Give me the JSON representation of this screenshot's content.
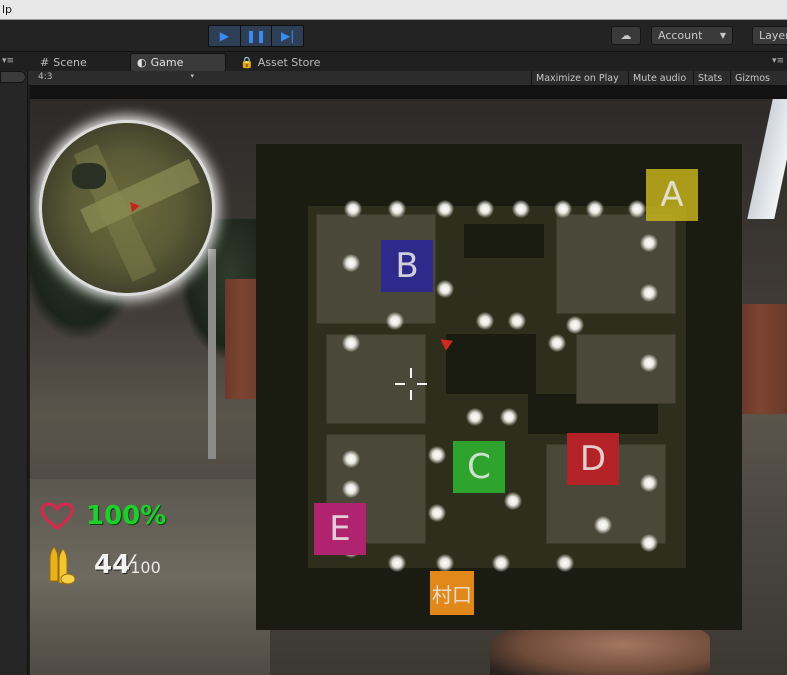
{
  "menubar": {
    "fragment": "lp"
  },
  "toolbar": {
    "play_icon": "play-icon",
    "pause_icon": "pause-icon",
    "step_icon": "step-icon",
    "cloud_icon": "cloud-icon",
    "account_label": "Account",
    "layers_label": "Layer",
    "accent_color": "#3a8cf2"
  },
  "tabs": [
    {
      "label": "Scene",
      "icon": "scene-grid-icon"
    },
    {
      "label": "Game",
      "icon": "game-pacman-icon",
      "active": true
    },
    {
      "label": "Asset Store",
      "icon": "asset-store-lock-icon"
    }
  ],
  "game_toolbar": {
    "aspect": "4:3",
    "buttons": [
      "Maximize on Play",
      "Mute audio",
      "Stats",
      "Gizmos"
    ]
  },
  "hud": {
    "health": "100%",
    "health_color": "#1ccf2a",
    "ammo_current": "44",
    "ammo_max": "100"
  },
  "map": {
    "markers": [
      {
        "id": "A",
        "color": "#c4b31c"
      },
      {
        "id": "B",
        "color": "#2e2a8c"
      },
      {
        "id": "C",
        "color": "#2ea42e"
      },
      {
        "id": "D",
        "color": "#b32226"
      },
      {
        "id": "E",
        "color": "#b0236f"
      },
      {
        "id": "村口",
        "color": "#e0881a"
      }
    ]
  }
}
